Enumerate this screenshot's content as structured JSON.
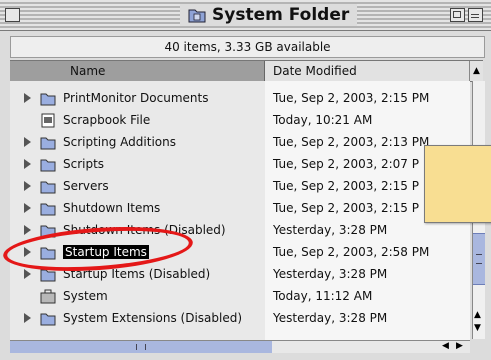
{
  "window": {
    "title": "System Folder",
    "info": "40 items, 3.33 GB available"
  },
  "columns": {
    "name": "Name",
    "date": "Date Modified"
  },
  "files": [
    {
      "name": "PrintMonitor Documents",
      "date": "Tue, Sep 2, 2003, 2:15 PM",
      "expandable": true,
      "icon": "folder-icon",
      "selected": false
    },
    {
      "name": "Scrapbook File",
      "date": "Today, 10:21 AM",
      "expandable": false,
      "icon": "document-icon",
      "selected": false
    },
    {
      "name": "Scripting Additions",
      "date": "Tue, Sep 2, 2003, 2:13 PM",
      "expandable": true,
      "icon": "folder-icon",
      "selected": false
    },
    {
      "name": "Scripts",
      "date": "Tue, Sep 2, 2003, 2:07 P",
      "expandable": true,
      "icon": "folder-icon",
      "selected": false
    },
    {
      "name": "Servers",
      "date": "Tue, Sep 2, 2003, 2:15 P",
      "expandable": true,
      "icon": "folder-icon",
      "selected": false
    },
    {
      "name": "Shutdown Items",
      "date": "Tue, Sep 2, 2003, 2:15 P",
      "expandable": true,
      "icon": "folder-icon",
      "selected": false
    },
    {
      "name": "Shutdown Items (Disabled)",
      "date": "Yesterday, 3:28 PM",
      "expandable": true,
      "icon": "folder-icon",
      "selected": false
    },
    {
      "name": "Startup Items",
      "date": "Tue, Sep 2, 2003, 2:58 PM",
      "expandable": true,
      "icon": "folder-icon",
      "selected": true
    },
    {
      "name": "Startup Items (Disabled)",
      "date": "Yesterday, 3:28 PM",
      "expandable": true,
      "icon": "folder-icon",
      "selected": false
    },
    {
      "name": "System",
      "date": "Today, 11:12 AM",
      "expandable": false,
      "icon": "suitcase-icon",
      "selected": false
    },
    {
      "name": "System Extensions (Disabled)",
      "date": "Yesterday, 3:28 PM",
      "expandable": true,
      "icon": "folder-icon",
      "selected": false
    }
  ],
  "colors": {
    "selection": "#000000",
    "sticky_note": "#f8de92",
    "annotation_circle": "#e41818",
    "scroll_thumb": "#a9b7df"
  }
}
